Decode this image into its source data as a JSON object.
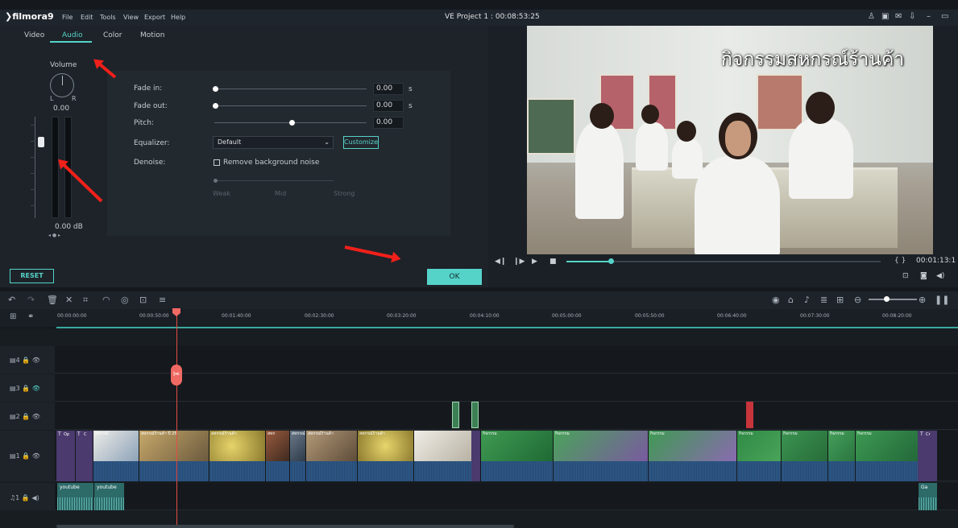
{
  "app": {
    "logo": "filmora9",
    "menu": [
      "File",
      "Edit",
      "Tools",
      "View",
      "Export",
      "Help"
    ],
    "project_title": "VE Project 1 : 00:08:53:25",
    "window_icons": [
      "person-icon",
      "save-icon",
      "mail-icon",
      "download-icon",
      "minimize-icon",
      "restore-icon"
    ]
  },
  "editor": {
    "tabs": [
      "Video",
      "Audio",
      "Color",
      "Motion"
    ],
    "active_tab": "Audio",
    "volume": {
      "label": "Volume",
      "left": "L",
      "right": "R",
      "value": "0.00",
      "db_value": "0.00",
      "db_unit": "dB",
      "dots": "◂ ● ▸"
    },
    "settings": {
      "fade_in": {
        "label": "Fade in:",
        "value": "0.00",
        "unit": "s",
        "level": 0
      },
      "fade_out": {
        "label": "Fade out:",
        "value": "0.00",
        "unit": "s",
        "level": 0
      },
      "pitch": {
        "label": "Pitch:",
        "value": "0.00",
        "level": 0.5
      },
      "equalizer": {
        "label": "Equalizer:",
        "selected": "Default",
        "customize_label": "Customize"
      },
      "denoise": {
        "label": "Denoise:",
        "checkbox_label": "Remove background noise",
        "checked": false,
        "levels": [
          "Weak",
          "Mid",
          "Strong"
        ]
      }
    },
    "reset_label": "RESET",
    "ok_label": "OK"
  },
  "preview": {
    "overlay_text": "กิจกรรมสหกรณ์ร้านค้า",
    "timecode": "00:01:13:1",
    "braces": "{ }",
    "progress": 0.14,
    "controls": [
      "rewind-icon",
      "step-icon",
      "play-icon",
      "stop-icon"
    ],
    "bottom_icons": [
      "render-icon",
      "snapshot-icon",
      "volume-icon"
    ]
  },
  "toolbar": {
    "left_icons": [
      "undo-icon",
      "redo-icon",
      "delete-icon",
      "cut-icon",
      "crop-icon",
      "speed-icon",
      "color-icon",
      "green-screen-icon",
      "audio-adjust-icon"
    ],
    "right_icons": [
      "render-preview-icon",
      "marker-icon",
      "voiceover-icon",
      "audio-mixer-icon",
      "pip-icon",
      "zoom-out-icon",
      "zoom-in-icon",
      "pause-icon"
    ]
  },
  "timeline": {
    "ruler": [
      "00:00:00:00",
      "00:00:50:00",
      "00:01:40:00",
      "00:02:30:00",
      "00:03:20:00",
      "00:04:10:00",
      "00:05:00:00",
      "00:05:50:00",
      "00:06:40:00",
      "00:07:30:00",
      "00:08:20:00"
    ],
    "tracks": [
      {
        "label": "4",
        "kind": "video"
      },
      {
        "label": "3",
        "kind": "video"
      },
      {
        "label": "2",
        "kind": "video"
      },
      {
        "label": "1",
        "kind": "video"
      },
      {
        "label": "1",
        "kind": "audio"
      }
    ],
    "video_clips_track1": [
      "Op",
      "C",
      "สหกรณ์",
      "สหกรณ์ร้านค้า ปี 25",
      "สหกรณ์ร้านค้า",
      "สหก",
      "สหกรณ์",
      "สหกรณ์ร้านค้า",
      "สหกรณ์ร้านค้า",
      "กิจกรรม",
      "กิจกรรม",
      "กิจกรรม",
      "กิจกรรม",
      "กิจกรรม",
      "กิจกรรม",
      "กิจกรรม",
      "Cr"
    ],
    "audio_clips": [
      "youtube",
      "youtube",
      "Ga"
    ]
  }
}
